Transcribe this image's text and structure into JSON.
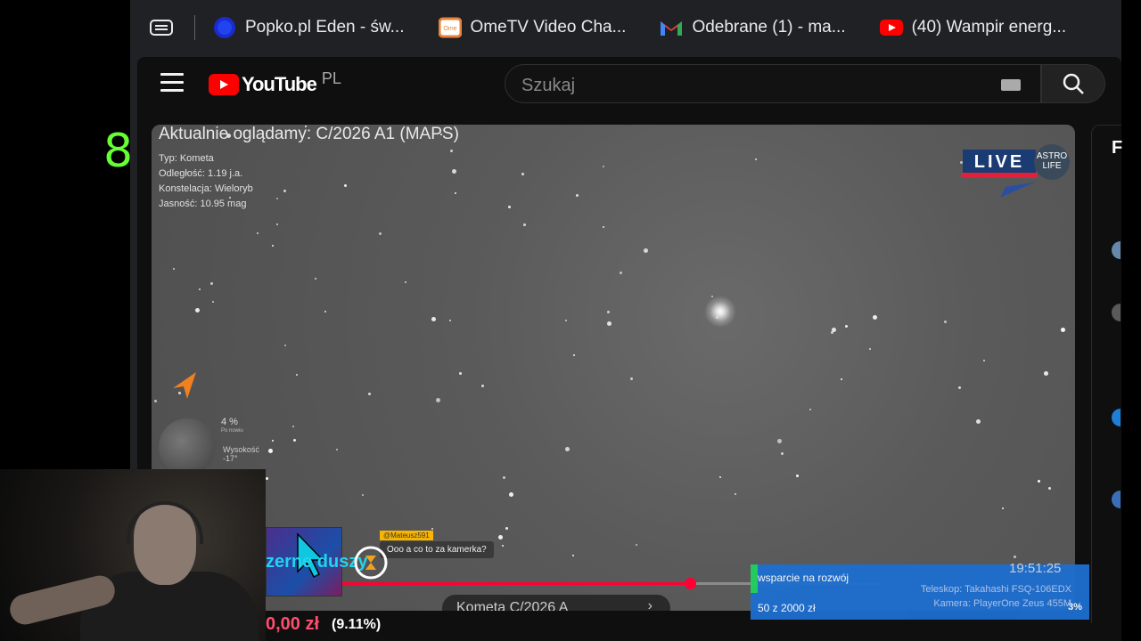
{
  "counter": "8",
  "tabs": [
    {
      "label": "Popko.pl Eden - św...",
      "icon": "globe-icon",
      "color": "#2233cc"
    },
    {
      "label": "OmeTV Video Cha...",
      "icon": "ometv-icon",
      "color": "#e8823a"
    },
    {
      "label": "Odebrane (1) - ma...",
      "icon": "gmail-icon",
      "color": "#ea4335"
    },
    {
      "label": "(40) Wampir energ...",
      "icon": "youtube-icon",
      "color": "#ff0000"
    }
  ],
  "youtube": {
    "logo_text": "YouTube",
    "country": "PL",
    "search_placeholder": "Szukaj"
  },
  "video": {
    "title_overlay": "Aktualnie oglądamy: C/2026 A1 (MAPS)",
    "info": {
      "type": "Typ: Kometa",
      "distance": "Odległość: 1.19 j.a.",
      "constellation": "Konstelacja: Wieloryb",
      "brightness": "Jasność: 10.95 mag"
    },
    "live": "LIVE",
    "brand": "ASTRO LIFE",
    "moon_percent": "4 %",
    "moon_sub": "Po nowiu",
    "moon_alt": "Wysokość",
    "moon_alt_val": "-17°",
    "chat_user": "@Mateusz591",
    "chat_message": "Ooo a co to za kamerka?",
    "chapter": "Kometa C/2026 A",
    "progress": 0.69,
    "chapter_arrow": "›"
  },
  "right_panel_letter": "F",
  "donation": {
    "title": "wsparcie na rozwój",
    "amount": "50 z 2000 zł",
    "percent": "3%"
  },
  "clock": "19:51:25",
  "telescope": "Teleskop: Takahashi FSQ-106EDX",
  "camera": "Kamera: PlayerOne Zeus 455M",
  "overlay_text": "zerne duszy",
  "bottom_amount": "0,00 zł",
  "bottom_percent": "(9.11%)"
}
